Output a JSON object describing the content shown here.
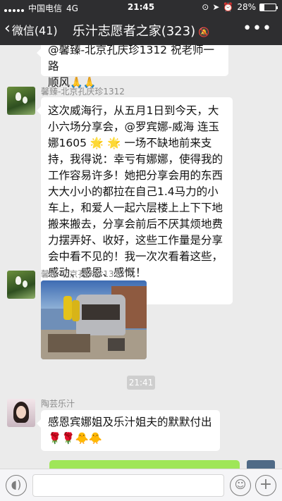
{
  "status_bar": {
    "carrier": "中国电信",
    "network": "4G",
    "time": "21:45",
    "battery_text": "28%",
    "battery_level": 0.28
  },
  "nav": {
    "back_label": "微信(41)",
    "title": "乐汁志愿者之家(323)"
  },
  "messages": [
    {
      "text_line1": "@馨臻-北京孔庆珍1312 祝老师一路",
      "text_line2": "顺风",
      "emoji": "🙏🙏"
    },
    {
      "sender": "馨臻-北京孔庆珍1312",
      "lines": [
        "这次威海行，从五月1日到今天，大",
        "小六场分享会，@罗宾娜-威海 连玉",
        "娜1605",
        "一场不缺地前来支",
        "持，我得说：幸亏有娜娜，使得我的",
        "工作容易许多！她把分享会用的东西",
        "大大小小的都拉在自己1.4马力的小",
        "车上，和爱人一起六层楼上上下下地",
        "搬来搬去，分享会前后不厌其烦地费",
        "力摆弄好、收好，这些工作量是分享",
        "会中看不见的！我一次次看着这些，",
        "感动、感恩、感慨！"
      ],
      "sparkles": "🌟 🌟"
    },
    {
      "sender": "馨臻-北京孔庆珍1312",
      "image_alt": "photo-message"
    },
    {
      "sender": "陶芸乐汁",
      "text": "感恩宾娜姐及乐汁姐夫的默默付出",
      "emoji_roses": "🌹🌹",
      "emoji_chicks": "🐥🐥"
    }
  ],
  "time_divider": "21:41",
  "input_bar": {
    "voice_icon": "voice-icon",
    "emoji_icon": "emoji-icon",
    "plus_icon": "plus-icon"
  }
}
